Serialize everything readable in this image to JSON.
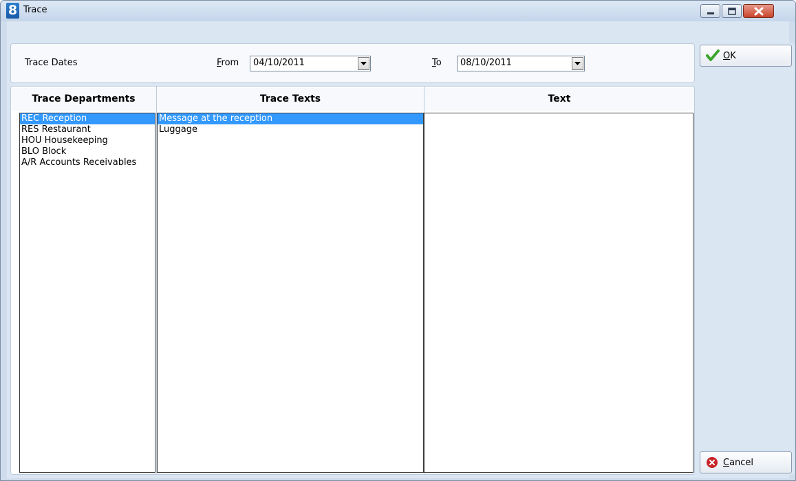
{
  "window": {
    "title": "Trace",
    "icon_char": "8"
  },
  "dates": {
    "label": "Trace Dates",
    "from_label_mnemonic": "F",
    "from_label_rest": "rom",
    "from_value": "04/10/2011",
    "to_label_mnemonic": "T",
    "to_label_rest": "o",
    "to_value": "08/10/2011"
  },
  "columns": {
    "departments_header": "Trace Departments",
    "texts_header": "Trace Texts",
    "text_header": "Text"
  },
  "departments": [
    {
      "label": "REC Reception",
      "selected": true
    },
    {
      "label": "RES Restaurant",
      "selected": false
    },
    {
      "label": "HOU Housekeeping",
      "selected": false
    },
    {
      "label": "BLO Block",
      "selected": false
    },
    {
      "label": "A/R Accounts Receivables",
      "selected": false
    }
  ],
  "trace_texts": [
    {
      "label": "Message at the reception",
      "selected": true
    },
    {
      "label": "Luggage",
      "selected": false
    }
  ],
  "buttons": {
    "ok_mnemonic": "O",
    "ok_rest": "K",
    "cancel_mnemonic": "C",
    "cancel_rest": "ancel"
  },
  "colors": {
    "selection": "#3399ff",
    "ok_check": "#3aa52a",
    "cancel_icon": "#c8242a"
  }
}
